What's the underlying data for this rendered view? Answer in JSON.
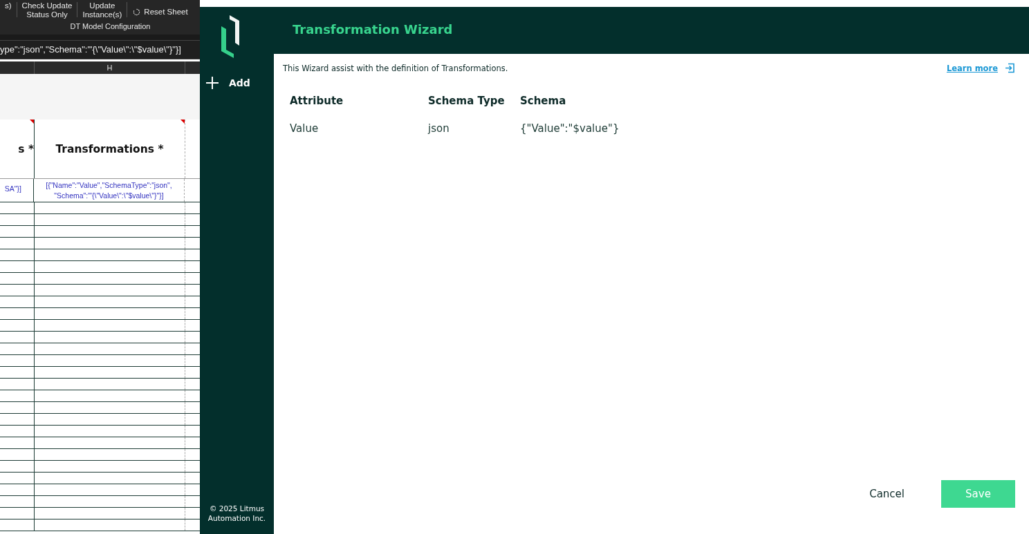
{
  "ribbon": {
    "groups": [
      {
        "lines": [
          "s)"
        ]
      },
      {
        "lines": [
          "Check Update",
          "Status Only"
        ]
      },
      {
        "lines": [
          "Update",
          "Instance(s)"
        ]
      }
    ],
    "reset_button": "Reset Sheet",
    "group_label": "DT Model Configuration"
  },
  "formula_bar": {
    "value": "ype\":\"json\",\"Schema\":\"'{\\\"Value\\\":\\\"$value\\\"}\"}]"
  },
  "sheet": {
    "column_header": "H",
    "headers": [
      "s *",
      "Transformations *"
    ],
    "row": [
      "SA\"}]",
      "[{\"Name\":\"Value\",\"SchemaType\":\"json\", \"Schema\":\"'{\\\"Value\\\":\\\"$value\\\"}\"}]"
    ]
  },
  "wizard": {
    "title": "Transformation Wizard",
    "add_button": "Add",
    "intro": "This Wizard assist with the definition of Transformations.",
    "learn_more": "Learn more",
    "columns": [
      "Attribute",
      "Schema Type",
      "Schema"
    ],
    "rows": [
      [
        "Value",
        "json",
        "{\"Value\":\"$value\"}"
      ]
    ],
    "footer": "© 2025 Litmus Automation Inc.",
    "cancel": "Cancel",
    "save": "Save"
  }
}
